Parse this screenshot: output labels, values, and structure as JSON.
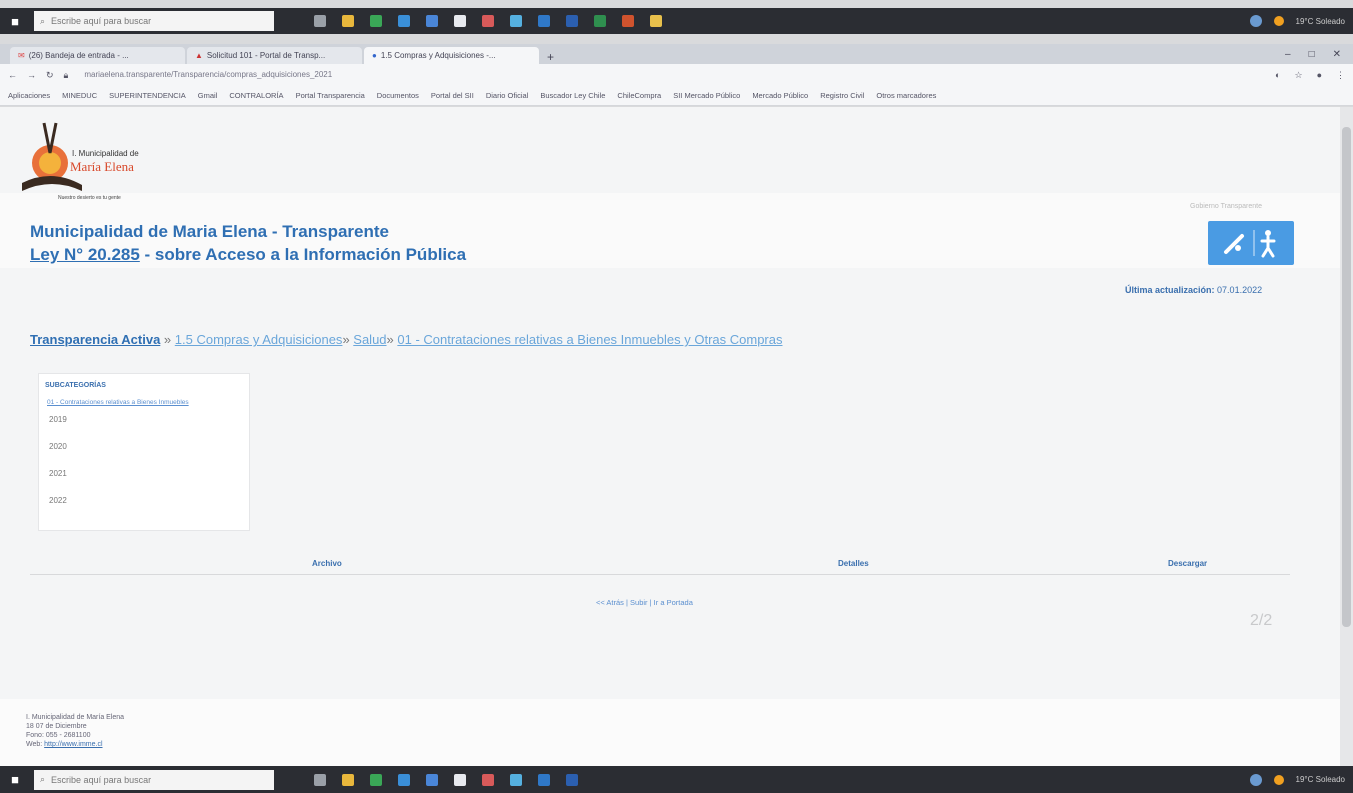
{
  "taskbar_top": {
    "search_placeholder": "Escribe aquí para buscar",
    "weather": "19°C Soleado",
    "icons": [
      {
        "name": "task-view-icon",
        "color": "#9aa0a8"
      },
      {
        "name": "file-explorer-icon",
        "color": "#e8b73c"
      },
      {
        "name": "chrome-icon",
        "color": "#3aa757"
      },
      {
        "name": "edge-icon",
        "color": "#3a8fd8"
      },
      {
        "name": "store-icon",
        "color": "#4a86d8"
      },
      {
        "name": "phone-icon",
        "color": "#e8eaef"
      },
      {
        "name": "paint-icon",
        "color": "#d85a5a"
      },
      {
        "name": "photos-icon",
        "color": "#55b0e0"
      },
      {
        "name": "outlook-icon",
        "color": "#2f78c8"
      },
      {
        "name": "word-icon",
        "color": "#2b5fb0"
      },
      {
        "name": "excel-icon",
        "color": "#2f8f4f"
      },
      {
        "name": "powerpoint-icon",
        "color": "#d0532e"
      },
      {
        "name": "folder-icon",
        "color": "#e8c04c"
      }
    ]
  },
  "browser": {
    "tabs": [
      {
        "label": "(26) Bandeja de entrada - ..."
      },
      {
        "label": "Solicitud 101 - Portal de Transp..."
      },
      {
        "label": "1.5 Compras y Adquisiciones -..."
      }
    ],
    "url": "mariaelena.transparente/Transparencia/compras_adquisiciones_2021"
  },
  "bookmarks": [
    "Aplicaciones",
    "MINEDUC",
    "SUPERINTENDENCIA",
    "Gmail",
    "CONTRALORÍA",
    "Portal Transparencia",
    "Documentos",
    "Portal del SII",
    "Diario Oficial",
    "Buscador Ley Chile",
    "ChileCompra",
    "SII Mercado Público",
    "Mercado Público",
    "Registro Civil",
    "Otros marcadores"
  ],
  "page": {
    "logo_line1": "I. Municipalidad de",
    "logo_line2": "María Elena",
    "logo_tagline": "Nuestro desierto es tu gente",
    "small_link": "Gobierno Transparente",
    "title": "Municipalidad de Maria Elena - Transparente",
    "subtitle_law": "Ley N° 20.285",
    "subtitle_rest": " - sobre Acceso a la Información Pública",
    "updated_label": "Última actualización:",
    "updated_date": "07.01.2022",
    "breadcrumb": {
      "root": "Transparencia Activa",
      "sep1": " » ",
      "item1": "1.5 Compras y Adquisiciones",
      "sep2": "» ",
      "item2": "Salud",
      "sep3": "» ",
      "item3": "01 - Contrataciones relativas a Bienes Inmuebles y Otras Compras"
    },
    "side_panel": {
      "heading": "SUBCATEGORÍAS",
      "link": "01 - Contrataciones relativas a Bienes Inmuebles",
      "years": [
        "2019",
        "2020",
        "2021",
        "2022"
      ]
    },
    "columns": {
      "archivo": "Archivo",
      "detalles": "Detalles",
      "descargar": "Descargar"
    },
    "pager": "<< Atrás | Subir | Ir a Portada",
    "faint_mark": "2/2",
    "footer_line1": "I. Municipalidad de María Elena",
    "footer_line2": "18 07 de Diciembre",
    "footer_line3": "Fono: 055 - 2681100",
    "footer_line4_label": "Web: ",
    "footer_line4_link": "http://www.imme.cl"
  }
}
